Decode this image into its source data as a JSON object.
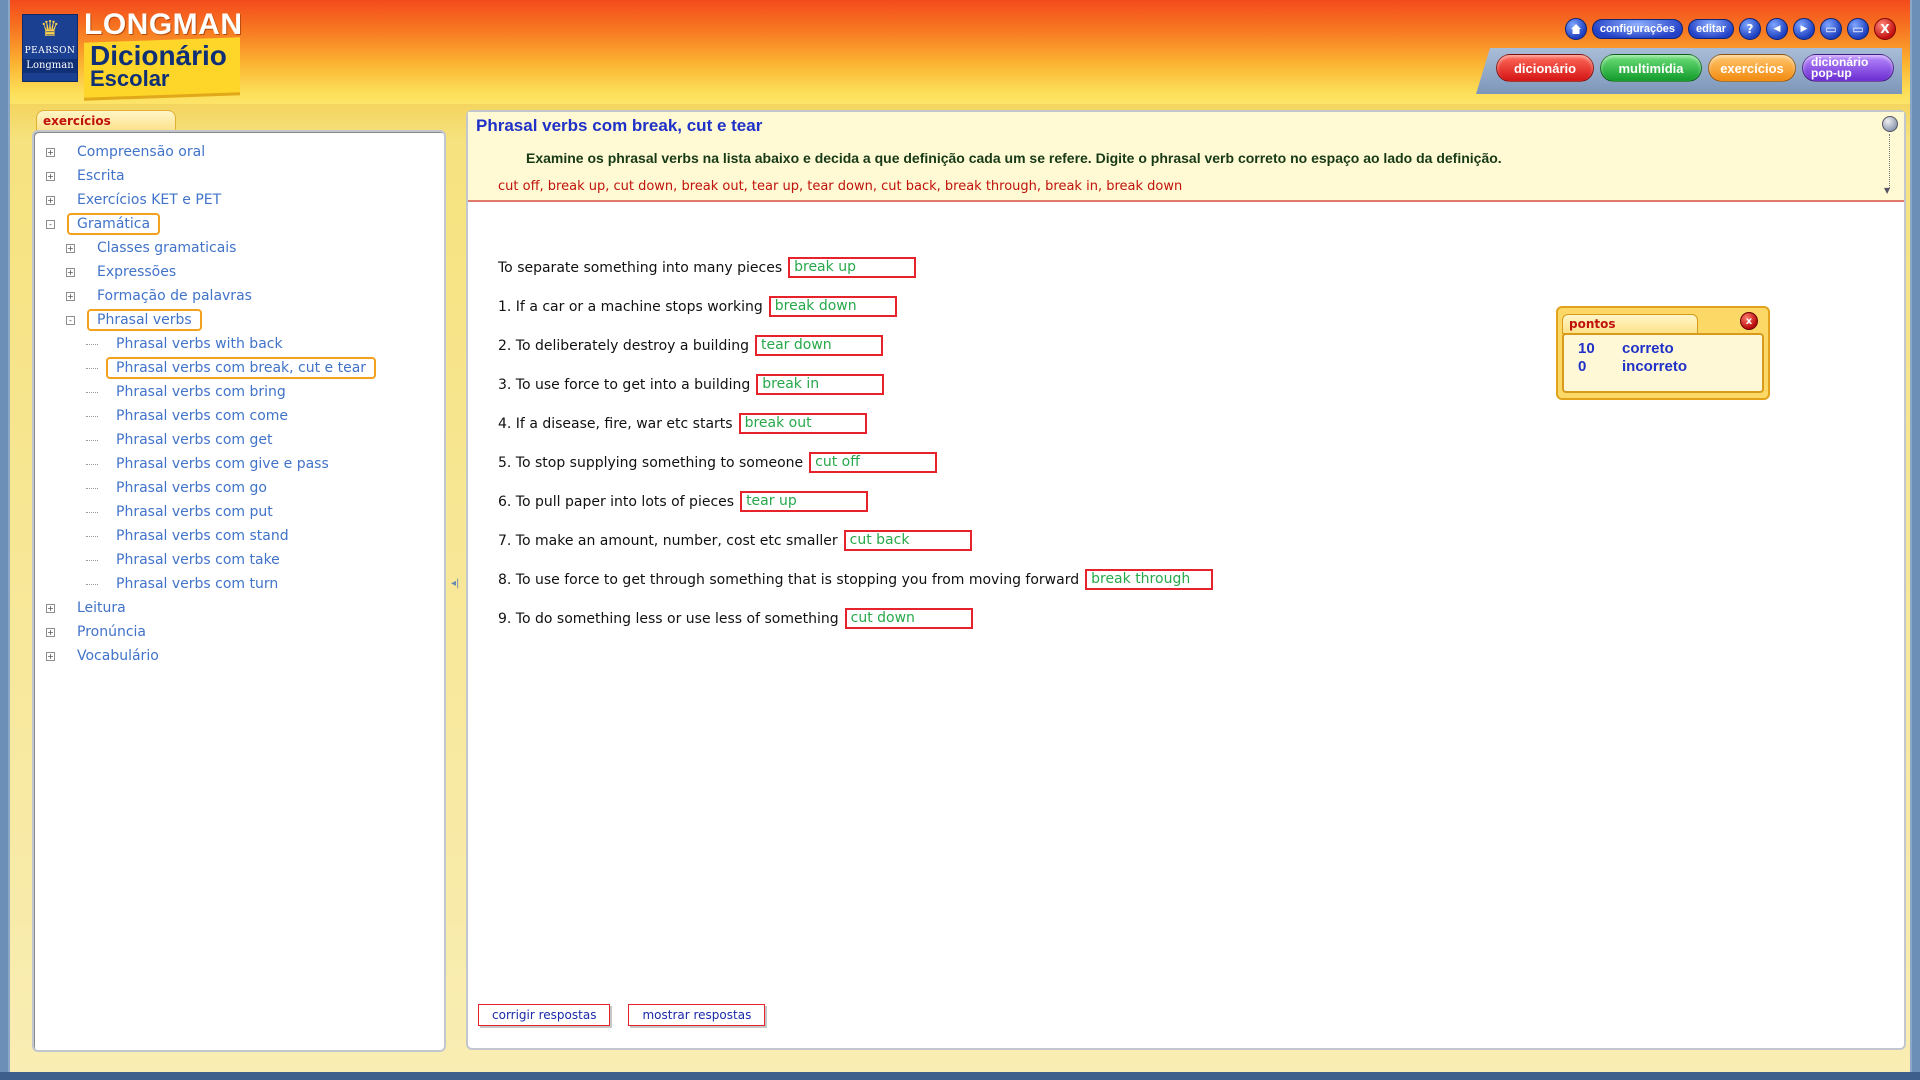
{
  "header": {
    "pearson_line1": "PEARSON",
    "pearson_line2": "Longman",
    "brand_top": "LONGMAN",
    "brand_line1": "Dicionário",
    "brand_line2": "Escolar",
    "util_buttons": {
      "home_icon": "house-icon",
      "config_label": "configurações",
      "edit_label": "editar",
      "help_symbol": "?",
      "back_symbol": "◀",
      "forward_symbol": "▶",
      "restore_symbol": "▭",
      "maximize_symbol": "▭",
      "close_symbol": "X"
    },
    "nav": {
      "dictionary": "dicionário",
      "multimedia": "multimídia",
      "exercises": "exercícios",
      "popup_line1": "dicionário",
      "popup_line2": "pop-up"
    }
  },
  "sidebar": {
    "tab_label": "exercícios",
    "items": [
      {
        "label": "Compreensão oral",
        "level": 0,
        "expander": "+"
      },
      {
        "label": "Escrita",
        "level": 0,
        "expander": "+"
      },
      {
        "label": "Exercícios KET e PET",
        "level": 0,
        "expander": "+"
      },
      {
        "label": "Gramática",
        "level": 0,
        "expander": "-",
        "selected": true
      },
      {
        "label": "Classes gramaticais",
        "level": 1,
        "expander": "+"
      },
      {
        "label": "Expressões",
        "level": 1,
        "expander": "+"
      },
      {
        "label": "Formação de palavras",
        "level": 1,
        "expander": "+"
      },
      {
        "label": "Phrasal verbs",
        "level": 1,
        "expander": "-",
        "selected": true
      },
      {
        "label": "Phrasal verbs with back",
        "level": 2
      },
      {
        "label": "Phrasal verbs com break, cut e tear",
        "level": 2,
        "selected": true
      },
      {
        "label": "Phrasal verbs com bring",
        "level": 2
      },
      {
        "label": "Phrasal verbs com come",
        "level": 2
      },
      {
        "label": "Phrasal verbs com get",
        "level": 2
      },
      {
        "label": "Phrasal verbs com give e pass",
        "level": 2
      },
      {
        "label": "Phrasal verbs com go",
        "level": 2
      },
      {
        "label": "Phrasal verbs com put",
        "level": 2
      },
      {
        "label": "Phrasal verbs com stand",
        "level": 2
      },
      {
        "label": "Phrasal verbs com take",
        "level": 2
      },
      {
        "label": "Phrasal verbs com turn",
        "level": 2
      },
      {
        "label": "Leitura",
        "level": 0,
        "expander": "+"
      },
      {
        "label": "Pronúncia",
        "level": 0,
        "expander": "+"
      },
      {
        "label": "Vocabulário",
        "level": 0,
        "expander": "+"
      }
    ]
  },
  "exercise": {
    "title": "Phrasal verbs com break, cut e tear",
    "instructions": "Examine os phrasal verbs na lista abaixo e decida a que definição cada um se refere. Digite o phrasal verb correto no espaço ao lado da definição.",
    "word_list": "cut off, break up, cut down, break out, tear up, tear down, cut back, break through, break in, break down",
    "rows": [
      {
        "question": "To separate something into many pieces",
        "answer": "break up"
      },
      {
        "question": "1. If a car or a machine stops working",
        "answer": "break down"
      },
      {
        "question": "2. To deliberately destroy a building",
        "answer": "tear down"
      },
      {
        "question": "3. To use force to get into a building",
        "answer": "break in"
      },
      {
        "question": "4. If a disease, fire, war etc starts",
        "answer": "break out"
      },
      {
        "question": "5. To stop supplying something to someone",
        "answer": "cut off"
      },
      {
        "question": "6. To pull paper into lots of pieces",
        "answer": "tear up"
      },
      {
        "question": "7. To make an amount, number, cost etc smaller",
        "answer": "cut back"
      },
      {
        "question": "8. To use force to get through something that is stopping you from moving forward",
        "answer": "break through"
      },
      {
        "question": "9. To do something less or use less of something",
        "answer": "cut down"
      }
    ],
    "check_button": "corrigir respostas",
    "show_button": "mostrar respostas"
  },
  "score": {
    "tab_label": "pontos",
    "close_symbol": "x",
    "correct_count": "10",
    "correct_label": "correto",
    "incorrect_count": "0",
    "incorrect_label": "incorreto"
  }
}
